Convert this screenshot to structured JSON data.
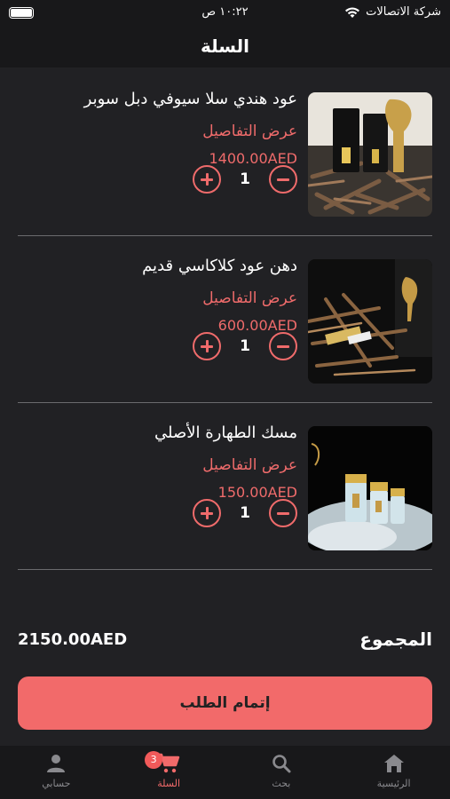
{
  "status_bar": {
    "carrier": "شركة الاتصالات",
    "time": "١٠:٢٢ ص"
  },
  "header": {
    "title": "السلة"
  },
  "cart": {
    "items": [
      {
        "name": "عود هندي سلا سيوفي دبل سوبر",
        "details_label": "عرض التفاصيل",
        "price": "1400.00AED",
        "quantity": "1"
      },
      {
        "name": "دهن عود كلاكاسي قديم",
        "details_label": "عرض التفاصيل",
        "price": "600.00AED",
        "quantity": "1"
      },
      {
        "name": "مسك الطهارة الأصلي",
        "details_label": "عرض التفاصيل",
        "price": "150.00AED",
        "quantity": "1"
      }
    ]
  },
  "summary": {
    "total_label": "المجموع",
    "total_value": "2150.00AED"
  },
  "checkout": {
    "label": "إتمام الطلب"
  },
  "tabs": [
    {
      "label": "الرئيسية",
      "icon": "home-icon"
    },
    {
      "label": "بحث",
      "icon": "search-icon"
    },
    {
      "label": "السلة",
      "icon": "cart-icon",
      "badge": "3"
    },
    {
      "label": "حسابي",
      "icon": "person-icon"
    }
  ],
  "colors": {
    "accent": "#f26a6a",
    "background": "#212124",
    "bar": "#18181a"
  }
}
